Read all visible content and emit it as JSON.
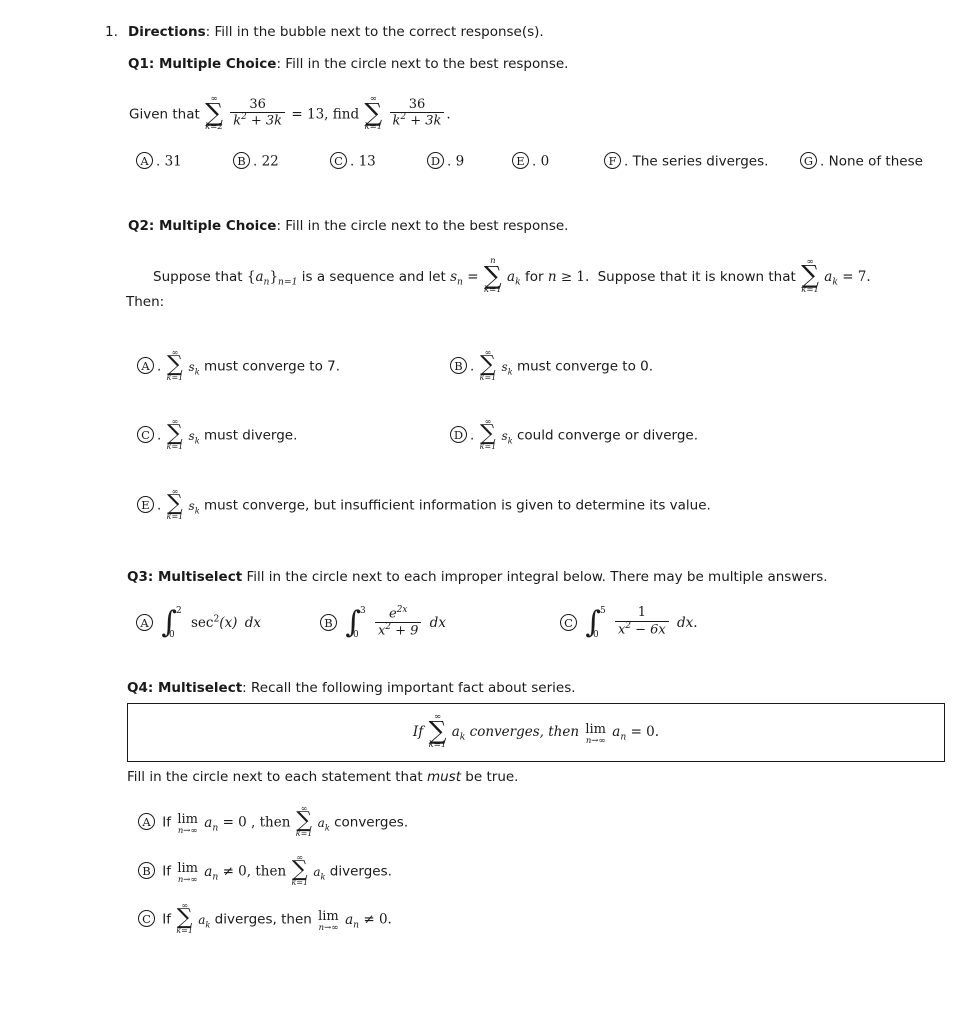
{
  "document": {
    "item_number": "1.",
    "directions_label": "Directions",
    "directions_text": ": Fill in the bubble next to the correct response(s)."
  },
  "q1": {
    "head_label": "Q1: Multiple Choice",
    "head_text": ": Fill in the circle next to the best response.",
    "stem": {
      "given_that": "Given that",
      "sum1": {
        "top": "∞",
        "bottom": "k=2",
        "num": "36",
        "den_base": "k",
        "den_exp": "2",
        "den_rest": "+ 3k"
      },
      "equals": "= 13, find",
      "sum2": {
        "top": "∞",
        "bottom": "k=1",
        "num": "36",
        "den_base": "k",
        "den_exp": "2",
        "den_rest": "+ 3k"
      },
      "period": "."
    },
    "options": [
      {
        "letter": "A",
        "dot": ".",
        "text": "31"
      },
      {
        "letter": "B",
        "dot": ".",
        "text": "22"
      },
      {
        "letter": "C",
        "dot": ".",
        "text": "13"
      },
      {
        "letter": "D",
        "dot": ".",
        "text": "9"
      },
      {
        "letter": "E",
        "dot": ".",
        "text": "0"
      },
      {
        "letter": "F",
        "dot": ".",
        "text": "The series diverges."
      },
      {
        "letter": "G",
        "dot": ".",
        "text": "None of these"
      }
    ]
  },
  "q2": {
    "head_label": "Q2: Multiple Choice",
    "head_text": ": Fill in the circle next to the best response.",
    "stem_part1": "Suppose that",
    "seq": {
      "open": "{",
      "a": "a",
      "asub": "n",
      "close": "}",
      "sub": "n=1"
    },
    "stem_part2": "is a sequence and let",
    "sn": {
      "s": "s",
      "sub": "n"
    },
    "eq": "=",
    "sum_sn": {
      "top": "n",
      "bottom": "k=1",
      "body_a": "a",
      "body_sub": "k"
    },
    "stem_part3": "for",
    "n_sym": "n",
    "ge": "≥ 1.",
    "stem_part4": "Suppose that it is known that",
    "sum_known": {
      "top": "∞",
      "bottom": "k=1",
      "body_a": "a",
      "body_sub": "k"
    },
    "known_value": "= 7.",
    "then_label": "Then:",
    "options": [
      {
        "letter": "A",
        "dot": ".",
        "sum": {
          "top": "∞",
          "bottom": "k=1",
          "body": "s",
          "body_sub": "k"
        },
        "text": "must converge to 7."
      },
      {
        "letter": "B",
        "dot": ".",
        "sum": {
          "top": "∞",
          "bottom": "k=1",
          "body": "s",
          "body_sub": "k"
        },
        "text": "must converge to 0."
      },
      {
        "letter": "C",
        "dot": ".",
        "sum": {
          "top": "∞",
          "bottom": "k=1",
          "body": "s",
          "body_sub": "k"
        },
        "text": "must diverge."
      },
      {
        "letter": "D",
        "dot": ".",
        "sum": {
          "top": "∞",
          "bottom": "k=1",
          "body": "s",
          "body_sub": "k"
        },
        "text": "could converge or diverge."
      },
      {
        "letter": "E",
        "dot": ".",
        "sum": {
          "top": "∞",
          "bottom": "k=1",
          "body": "s",
          "body_sub": "k"
        },
        "text": "must converge, but insufficient information is given to determine its value."
      }
    ]
  },
  "q3": {
    "head_label": "Q3: Multiselect",
    "head_text": " Fill in the circle next to each improper integral below.  There may be multiple answers.",
    "options": [
      {
        "letter": "A",
        "upper": "2",
        "lower": "0",
        "integrand_kind": "plain",
        "integrand": "sec",
        "integrand_exp": "2",
        "integrand_arg": "(x)",
        "dx": "dx",
        "trail": ""
      },
      {
        "letter": "B",
        "upper": "3",
        "lower": "0",
        "integrand_kind": "fraction",
        "num_base": "e",
        "num_exp": "2x",
        "den_base": "x",
        "den_exp": "2",
        "den_rest": "+ 9",
        "dx": "dx",
        "trail": ""
      },
      {
        "letter": "C",
        "upper": "5",
        "lower": "0",
        "integrand_kind": "fraction",
        "num_base": "1",
        "num_exp": "",
        "den_base": "x",
        "den_exp": "2",
        "den_rest": "− 6x",
        "dx": "dx",
        "trail": "."
      }
    ]
  },
  "q4": {
    "head_label": "Q4: Multiselect",
    "head_text": ": Recall the following important fact about series.",
    "fact": {
      "if": "If",
      "sum": {
        "top": "∞",
        "bottom": "k=1",
        "body": "a",
        "body_sub": "k"
      },
      "converges_then": "converges, then",
      "lim_top": "lim",
      "lim_bottom": "n→∞",
      "a_n": "a",
      "a_n_sub": "n",
      "equals_zero": "= 0."
    },
    "instruction_pre": "Fill in the circle next to each statement that ",
    "instruction_em": "must",
    "instruction_post": " be true.",
    "options": [
      {
        "letter": "A",
        "if": "If",
        "lim_top": "lim",
        "lim_bottom": "n→∞",
        "a_sym": "a",
        "a_sub": "n",
        "rel": "= 0 , then",
        "sum": {
          "top": "∞",
          "bottom": "k=1",
          "body": "a",
          "body_sub": "k"
        },
        "tail": "converges."
      },
      {
        "letter": "B",
        "if": "If",
        "lim_top": "lim",
        "lim_bottom": "n→∞",
        "a_sym": "a",
        "a_sub": "n",
        "rel": "≠ 0, then",
        "sum": {
          "top": "∞",
          "bottom": "k=1",
          "body": "a",
          "body_sub": "k"
        },
        "tail": "diverges."
      },
      {
        "letter": "C",
        "if": "If",
        "sum": {
          "top": "∞",
          "bottom": "k=1",
          "body": "a",
          "body_sub": "k"
        },
        "mid": "diverges, then",
        "lim_top": "lim",
        "lim_bottom": "n→∞",
        "a_sym": "a",
        "a_sub": "n",
        "tail": "≠ 0."
      }
    ]
  }
}
